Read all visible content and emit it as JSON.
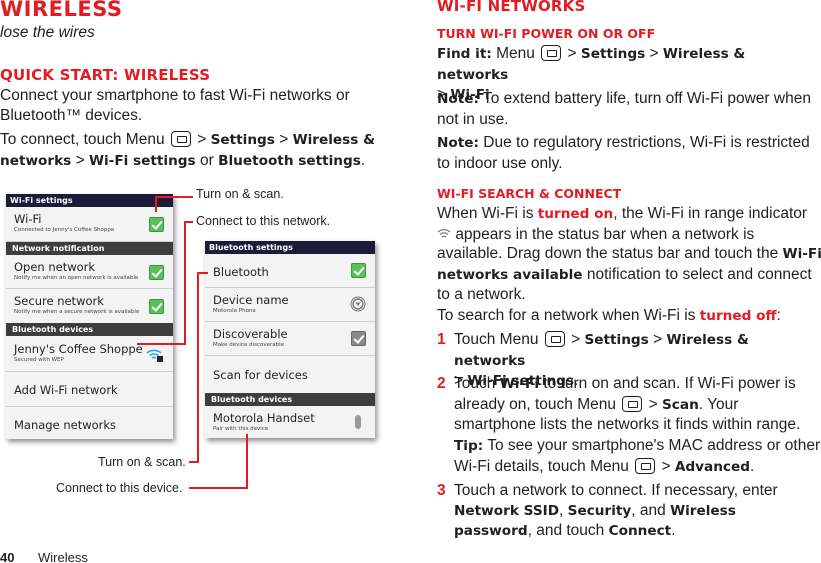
{
  "left": {
    "page_title": "Wireless",
    "tagline": "lose the wires",
    "quick_start_heading": "Quick start: Wireless",
    "intro": "Connect your smartphone to fast Wi-Fi networks or Bluetooth™ devices.",
    "connect_prefix": "To connect, touch Menu",
    "connect_path": [
      {
        "text": "Settings",
        "bold": true
      },
      {
        "text": "Wireless & networks",
        "bold": true
      },
      {
        "text": "Wi-Fi settings",
        "bold": true
      }
    ],
    "connect_or": "or",
    "connect_last": "Bluetooth settings"
  },
  "wifi_panel": {
    "title": "Wi-Fi settings",
    "rows": [
      {
        "title": "Wi-Fi",
        "subtitle": "Connected to Jenny's Coffee Shoppe",
        "control": "checkbox-checked"
      }
    ],
    "category_1": "Network notification",
    "notif_rows": [
      {
        "title": "Open network",
        "subtitle": "Notify me when an open network is available",
        "control": "checkbox-checked"
      },
      {
        "title": "Secure network",
        "subtitle": "Notify me when a secure network is available",
        "control": "checkbox-checked"
      }
    ],
    "category_2": "Bluetooth devices",
    "network": {
      "title": "Jenny's Coffee Shoppe",
      "subtitle": "Secured with WEP",
      "icon": "wifi-lock-icon"
    },
    "add_network": "Add Wi-Fi network",
    "manage_networks": "Manage networks"
  },
  "bt_panel": {
    "title": "Bluetooth settings",
    "bluetooth": "Bluetooth",
    "device_name": {
      "title": "Device name",
      "subtitle": "Motorola Phone"
    },
    "discoverable": {
      "title": "Discoverable",
      "subtitle": "Make device discoverable"
    },
    "scan": "Scan for devices",
    "category": "Bluetooth devices",
    "device": {
      "title": "Motorola Handset",
      "subtitle": "Pair with this device"
    }
  },
  "callouts": {
    "wifi_turn_on": "Turn on & scan.",
    "wifi_connect": "Connect to this network.",
    "bt_turn_on": "Turn on & scan.",
    "bt_connect": "Connect to this device."
  },
  "footer": {
    "page_number": "40",
    "section": "Wireless"
  },
  "right": {
    "heading": "Wi-Fi networks",
    "sub1": "Turn Wi-Fi power on or off",
    "find_it_label": "Find it:",
    "find_it_menu": "Menu",
    "find_it_path": [
      "Settings",
      "Wireless & networks",
      "Wi-Fi"
    ],
    "note1_label": "Note:",
    "note1": "To extend battery life, turn off Wi-Fi power when not in use.",
    "note2_label": "Note:",
    "note2": "Due to regulatory restrictions, Wi-Fi is restricted to indoor use only.",
    "sub2": "Wi-Fi search & connect",
    "p1_a": "When Wi-Fi is",
    "p1_turned_on": "turned on",
    "p1_b": ", the Wi-Fi in range indicator",
    "p1_c": "appears in the status bar when a network is available. Drag down the status bar and touch the",
    "p1_bold": "Wi-Fi networks available",
    "p1_d": "notification to select and connect to a network.",
    "p2_a": "To search for a network when Wi-Fi is",
    "p2_turned_off": "turned off",
    "p2_b": ":",
    "steps": [
      {
        "num": "1",
        "a": "Touch Menu",
        "b1": "Settings",
        "b2": "Wireless & networks",
        "b3": "Wi-Fi settings"
      },
      {
        "num": "2",
        "a": "Touch",
        "b1": "Wi-Fi",
        "c": "to turn on and scan. If Wi-Fi power is already on, touch Menu",
        "b2": "Scan",
        "d": ". Your smartphone lists the networks it finds within range."
      },
      {
        "num": "3",
        "a": "Touch a network to connect. If necessary, enter",
        "b1": "Network SSID",
        "b2": "Security",
        "c": ", and",
        "b3": "Wireless password",
        "d": ", and touch",
        "b4": "Connect"
      }
    ],
    "tip_label": "Tip:",
    "tip_a": "To see your smartphone's MAC address or other Wi-Fi details, touch Menu",
    "tip_b": "Advanced"
  }
}
